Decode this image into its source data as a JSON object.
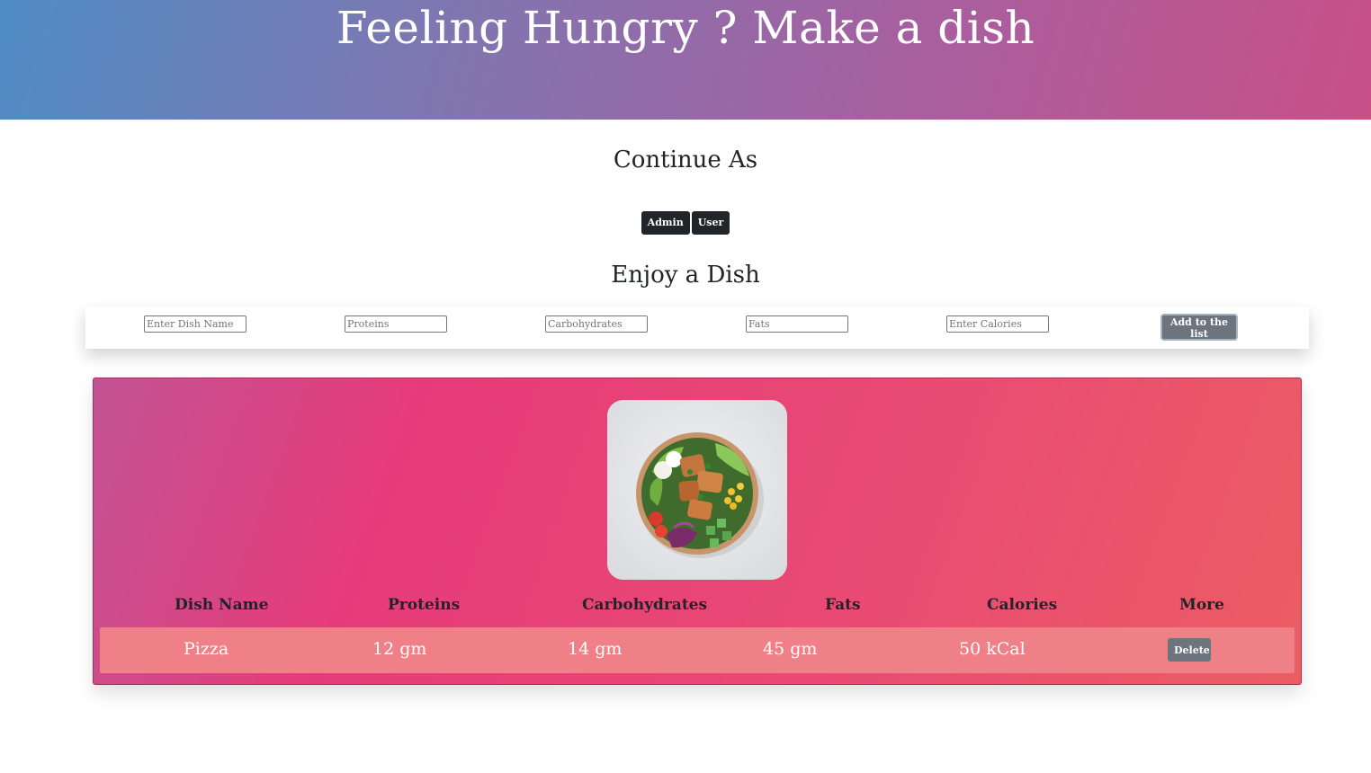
{
  "header": {
    "title": "Feeling Hungry ? Make a dish"
  },
  "role_section": {
    "title": "Continue As",
    "admin_label": "Admin",
    "user_label": "User"
  },
  "form_section": {
    "title": "Enjoy a Dish",
    "dish_name_placeholder": "Enter Dish Name",
    "proteins_placeholder": "Proteins",
    "carbohydrates_placeholder": "Carbohydrates",
    "fats_placeholder": "Fats",
    "calories_placeholder": "Enter Calories",
    "add_button_label": "Add to the list"
  },
  "dish_card": {
    "image": "salad-bowl-photo",
    "columns": [
      "Dish Name",
      "Proteins",
      "Carbohydrates",
      "Fats",
      "Calories",
      "More"
    ],
    "rows": [
      {
        "dish_name": "Pizza",
        "proteins": "12 gm",
        "carbohydrates": "14 gm",
        "fats": "45 gm",
        "calories": "50 kCal",
        "action_label": "Delete"
      }
    ]
  },
  "colors": {
    "header_gradient_start": "#4f8cc4",
    "header_gradient_end": "#c85087",
    "card_gradient_start": "#c25394",
    "card_gradient_end": "#ec5d63",
    "row_background": "#f08088",
    "dark_button": "#212529",
    "secondary_button": "#6c757d"
  }
}
